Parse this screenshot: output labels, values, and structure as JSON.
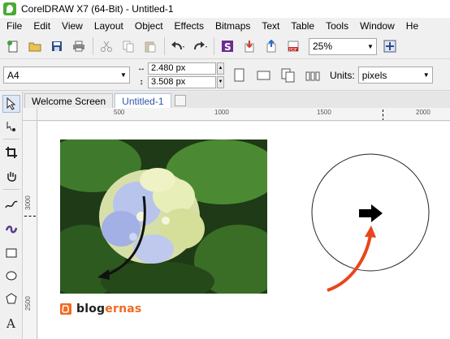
{
  "window": {
    "title": "CorelDRAW X7 (64-Bit) - Untitled-1"
  },
  "menu": [
    {
      "ul": "F",
      "rest": "ile"
    },
    {
      "ul": "E",
      "rest": "dit"
    },
    {
      "ul": "V",
      "rest": "iew"
    },
    {
      "ul": "L",
      "rest": "ayout"
    },
    {
      "ul": "O",
      "rest": "bject"
    },
    {
      "ul": "E",
      "rest": "ffects",
      "pre": ""
    },
    {
      "ul": "B",
      "rest": "itmaps"
    },
    {
      "ul": "T",
      "rest": "ext",
      "pre": "Te",
      "post": "t",
      "mid": "x"
    },
    {
      "ul": "T",
      "rest": "able"
    },
    {
      "ul": "T",
      "rest": "ools"
    },
    {
      "ul": "W",
      "rest": "indow"
    },
    {
      "ul": "H",
      "rest": "e"
    }
  ],
  "menu_labels": [
    "File",
    "Edit",
    "View",
    "Layout",
    "Object",
    "Effects",
    "Bitmaps",
    "Text",
    "Table",
    "Tools",
    "Window",
    "He"
  ],
  "toolbar": {
    "zoom_value": "25%",
    "icons": [
      "new-document-icon",
      "open-folder-icon",
      "save-icon",
      "print-icon",
      "cut-icon",
      "copy-icon",
      "paste-icon",
      "undo-icon",
      "redo-icon",
      "corel-connect-icon",
      "import-icon",
      "export-icon",
      "export-pdf-icon",
      "full-screen-preview-icon"
    ]
  },
  "propbar": {
    "page_size": "A4",
    "width": "2.480 px",
    "height": "3.508 px",
    "units_label": "Units:",
    "units_value": "pixels"
  },
  "tabs": [
    {
      "label": "Welcome Screen",
      "active": false
    },
    {
      "label": "Untitled-1",
      "active": true
    }
  ],
  "ruler": {
    "h_labels": [
      "500",
      "1000",
      "1500",
      "2000"
    ],
    "v_labels": [
      "3000",
      "2500"
    ]
  },
  "canvas": {
    "logo_main": "blog",
    "logo_accent": "ernas"
  },
  "colors": {
    "accent_orange": "#f26a21",
    "tab_active_text": "#3355aa",
    "canvas_bg": "#ffffff"
  }
}
